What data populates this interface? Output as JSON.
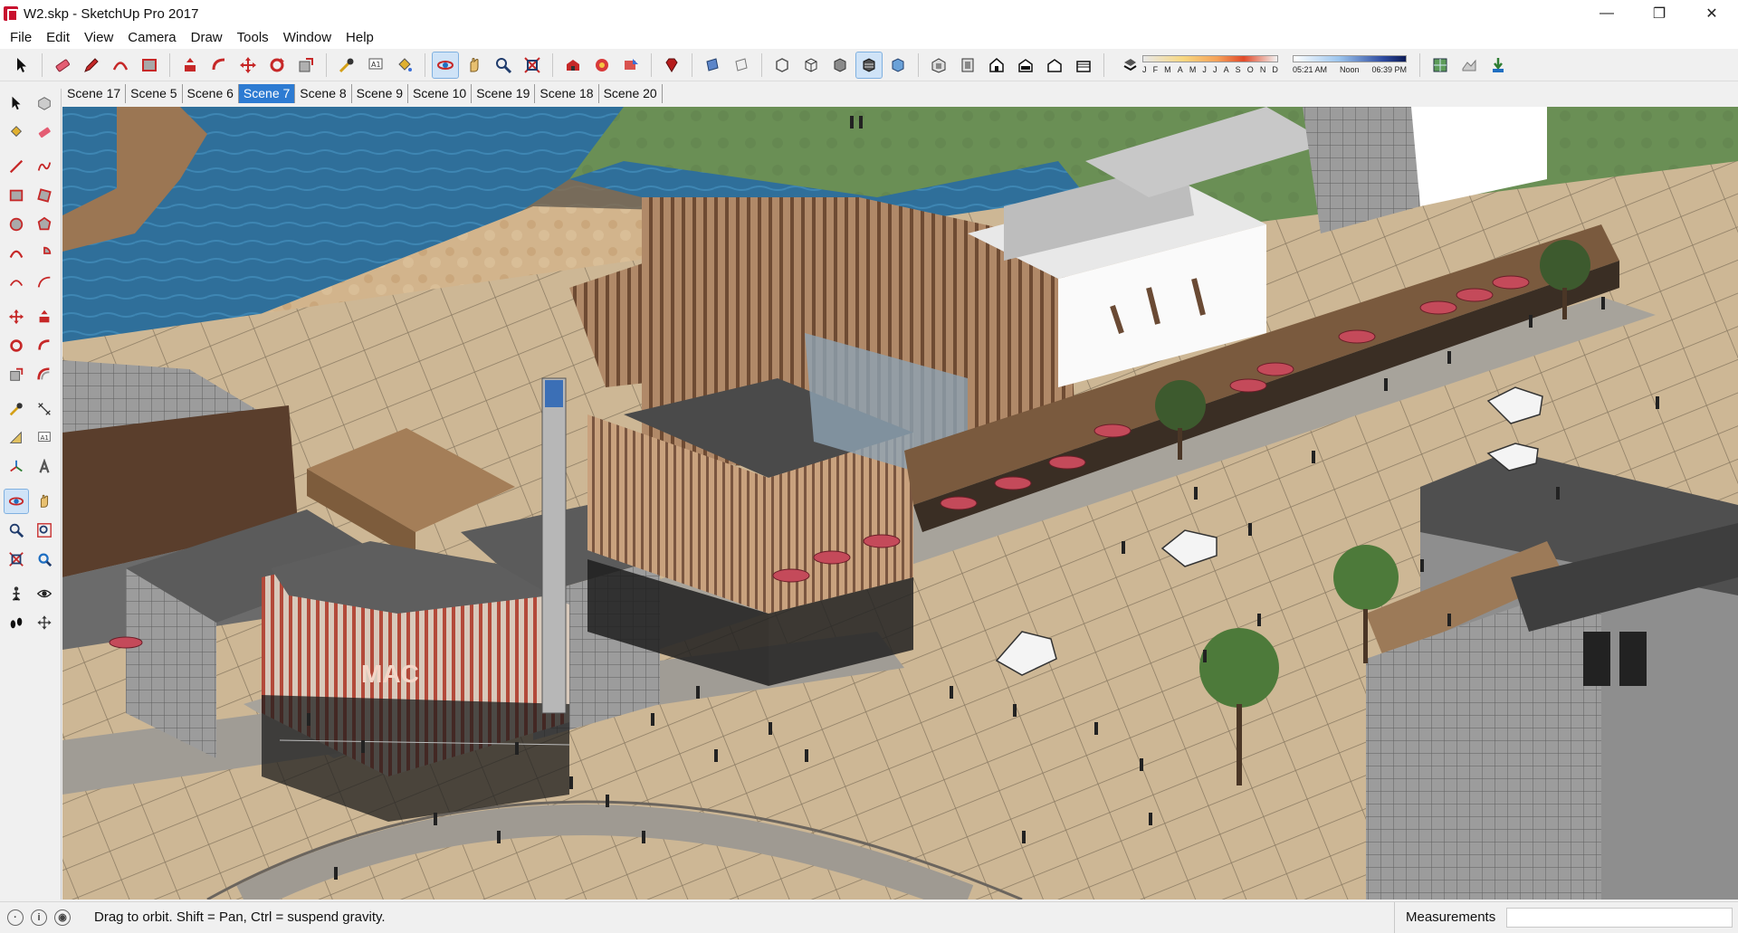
{
  "window": {
    "title": "W2.skp - SketchUp Pro 2017",
    "controls": {
      "minimize": "—",
      "maximize": "❐",
      "close": "✕"
    }
  },
  "menu": [
    "File",
    "Edit",
    "View",
    "Camera",
    "Draw",
    "Tools",
    "Window",
    "Help"
  ],
  "toolbar": {
    "icons": [
      "select-icon",
      "eraser-icon",
      "pencil-icon",
      "arc-icon",
      "rectangle-icon",
      "push-pull-icon",
      "follow-me-icon",
      "move-icon",
      "rotate-icon",
      "scale-icon",
      "tape-measure-icon",
      "text-icon",
      "paint-bucket-icon",
      "orbit-icon",
      "pan-icon",
      "zoom-icon",
      "zoom-extents-icon",
      "warehouse-icon",
      "extension-warehouse-icon",
      "share-model-icon",
      "ruby-icon",
      "section-plane-icon",
      "section-display-icon",
      "xray-icon",
      "wireframe-icon",
      "shaded-icon",
      "textured-icon",
      "monochrome-icon",
      "iso-view-icon",
      "top-view-icon",
      "front-view-icon",
      "right-view-icon",
      "back-view-icon",
      "left-view-icon",
      "shadows-icon",
      "add-location-icon",
      "toggle-terrain-icon",
      "get-photo-icon"
    ],
    "shadow_months": [
      "J",
      "F",
      "M",
      "A",
      "M",
      "J",
      "J",
      "A",
      "S",
      "O",
      "N",
      "D"
    ],
    "time_labels": {
      "start": "05:21 AM",
      "mid": "Noon",
      "end": "06:39 PM"
    }
  },
  "scenes": {
    "tabs": [
      "Scene 17",
      "Scene 5",
      "Scene 6",
      "Scene 7",
      "Scene 8",
      "Scene 9",
      "Scene 10",
      "Scene 19",
      "Scene 18",
      "Scene 20"
    ],
    "active": "Scene 7"
  },
  "left_tools": [
    [
      "select-icon",
      "component-icon"
    ],
    [
      "paint-bucket-icon",
      "eraser-icon"
    ],
    [
      "line-icon",
      "freehand-icon"
    ],
    [
      "rectangle-icon",
      "rotated-rectangle-icon"
    ],
    [
      "circle-icon",
      "polygon-icon"
    ],
    [
      "arc-icon",
      "pie-icon"
    ],
    [
      "two-point-arc-icon",
      "three-point-arc-icon"
    ],
    [
      "move-icon",
      "push-pull-icon"
    ],
    [
      "rotate-icon",
      "follow-me-icon"
    ],
    [
      "scale-icon",
      "offset-icon"
    ],
    [
      "tape-measure-icon",
      "dimension-icon"
    ],
    [
      "protractor-icon",
      "text-icon"
    ],
    [
      "axes-icon",
      "3d-text-icon"
    ],
    [
      "orbit-icon",
      "pan-icon"
    ],
    [
      "zoom-icon",
      "zoom-window-icon"
    ],
    [
      "zoom-extents-icon",
      "previous-view-icon"
    ],
    [
      "position-camera-icon",
      "look-around-icon"
    ],
    [
      "walk-icon",
      "section-plane-icon"
    ]
  ],
  "status": {
    "hint": "Drag to orbit. Shift = Pan, Ctrl = suspend gravity.",
    "measurements_label": "Measurements",
    "measurements_value": ""
  },
  "viewport": {
    "building_sign": "MAC"
  }
}
